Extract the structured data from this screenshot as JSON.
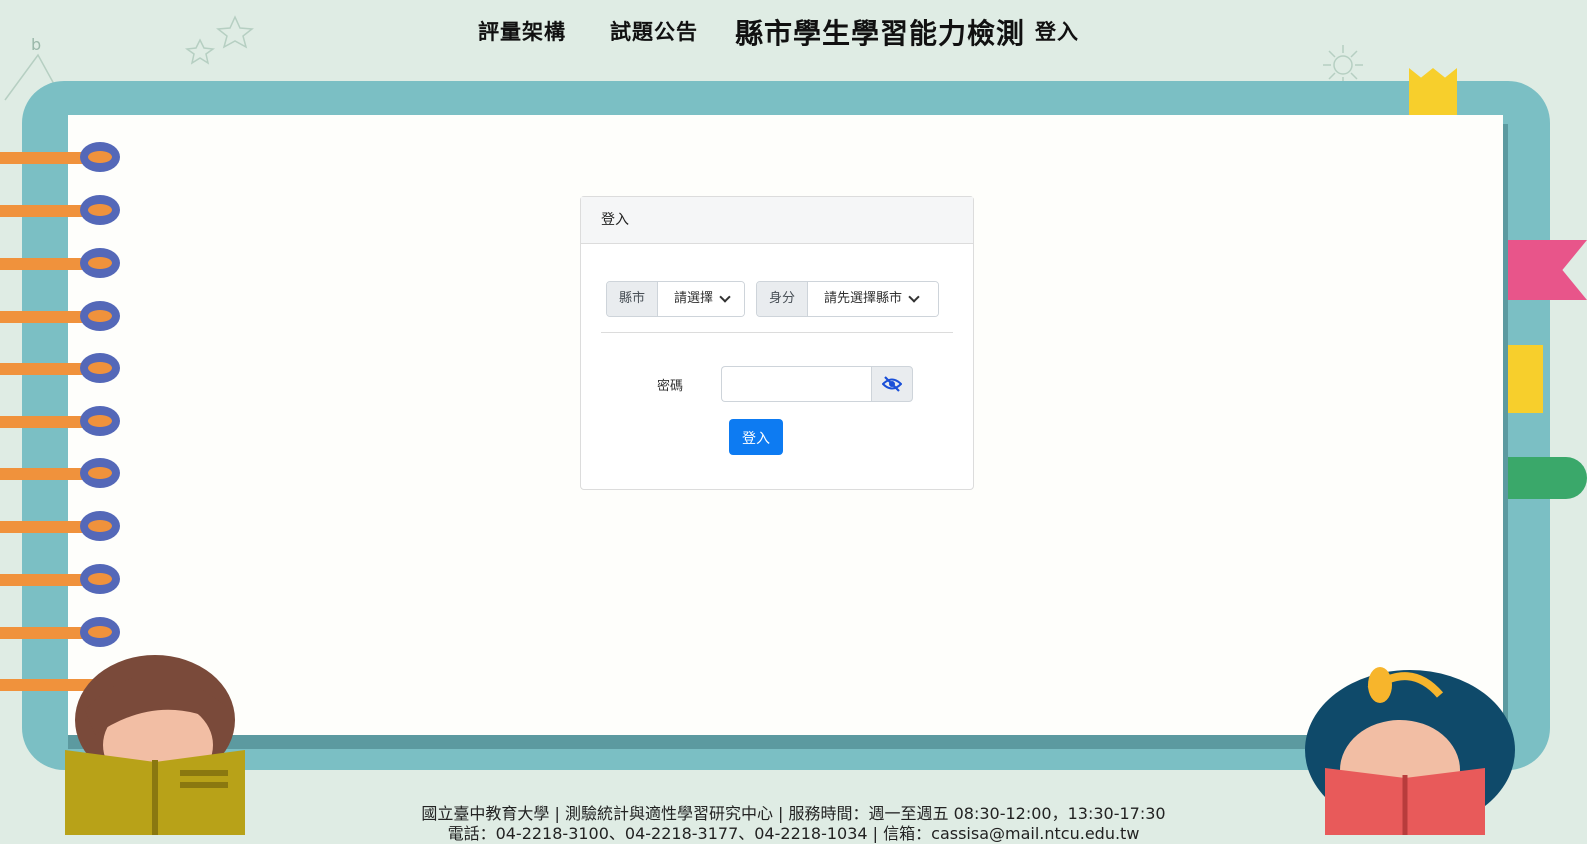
{
  "nav": {
    "assessment_framework": "評量架構",
    "test_announcement": "試題公告",
    "site_title": "縣市學生學習能力檢測",
    "login": "登入"
  },
  "login_card": {
    "header": "登入",
    "county_label": "縣市",
    "county_select_value": "請選擇",
    "identity_label": "身分",
    "identity_select_value": "請先選擇縣市",
    "password_label": "密碼",
    "password_value": "",
    "submit_label": "登入"
  },
  "footer": {
    "line1": "國立臺中教育大學 | 測驗統計與適性學習研究中心 | 服務時間：週一至週五 08:30-12:00，13:30-17:30",
    "line2": "電話：04-2218-3100、04-2218-3177、04-2218-1034 | 信箱：cassisa@mail.ntcu.edu.tw"
  },
  "colors": {
    "background": "#dfece4",
    "notebook_frame": "#7bbfc4",
    "ring": "#f0923c",
    "ring_eye": "#5468b8",
    "primary_button": "#0d7bf2"
  }
}
